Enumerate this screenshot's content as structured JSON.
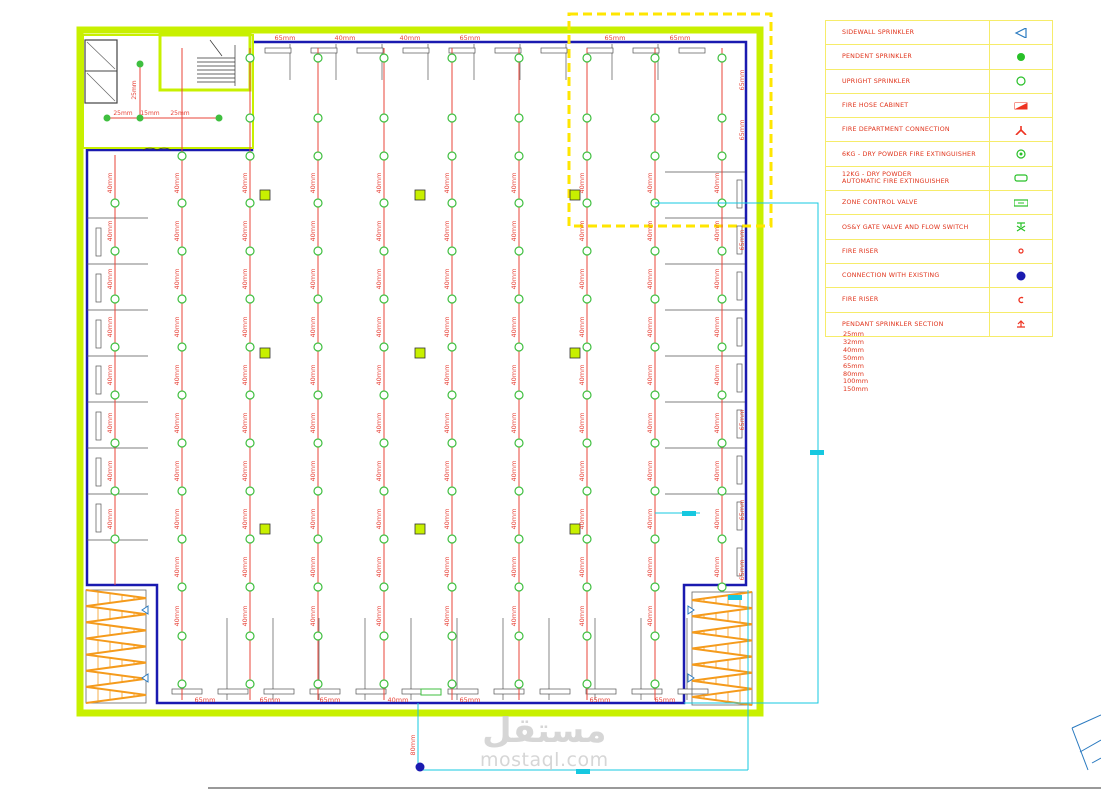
{
  "legend": [
    {
      "label": "SIDEWALL SPRINKLER",
      "icon": "sidewall-sprinkler-icon"
    },
    {
      "label": "PENDENT SPRINKLER",
      "icon": "pendent-sprinkler-icon"
    },
    {
      "label": "UPRIGHT SPRINKLER",
      "icon": "upright-sprinkler-icon"
    },
    {
      "label": "FIRE HOSE CABINET",
      "icon": "fire-hose-cabinet-icon"
    },
    {
      "label": "FIRE DEPARTMENT CONNECTION",
      "icon": "fire-department-connection-icon"
    },
    {
      "label": "6KG - DRY POWDER FIRE EXTINGUISHER",
      "icon": "dry-powder-extinguisher-icon"
    },
    {
      "label": "12KG - DRY POWDER\nAUTOMATIC FIRE EXTINGUISHER",
      "icon": "automatic-extinguisher-icon"
    },
    {
      "label": "ZONE CONTROL VALVE",
      "icon": "zone-control-valve-icon"
    },
    {
      "label": "OS&Y GATE VALVE AND FLOW SWITCH",
      "icon": "gate-valve-icon"
    },
    {
      "label": "FIRE RISER",
      "icon": "fire-riser-icon"
    },
    {
      "label": "CONNECTION WITH EXISTING",
      "icon": "connection-existing-icon"
    },
    {
      "label": "FIRE RISER",
      "icon": "fire-riser-c-icon"
    },
    {
      "label": "PENDANT SPRINKLER SECTION",
      "icon": "pendant-section-icon"
    }
  ],
  "pipe_sizes": [
    "25mm",
    "32mm",
    "40mm",
    "50mm",
    "65mm",
    "80mm",
    "100mm",
    "150mm"
  ],
  "labels": {
    "branch": "40mm",
    "main": "65mm",
    "stair_branch": "25mm",
    "stair_mid": "15mm",
    "riser": "80mm"
  },
  "watermark": {
    "arabic": "مستقل",
    "latin": "mostaql.com"
  },
  "colors": {
    "outer_wall": "#c8f000",
    "pipe_boundary": "#1a1ab0",
    "branch_pipe": "#e8443a",
    "sprinkler": "#3fbf3f",
    "column": "#c8f000",
    "dimension": "#16c8e0",
    "highlight": "#ffe600",
    "ramp": "#f59b1c"
  }
}
